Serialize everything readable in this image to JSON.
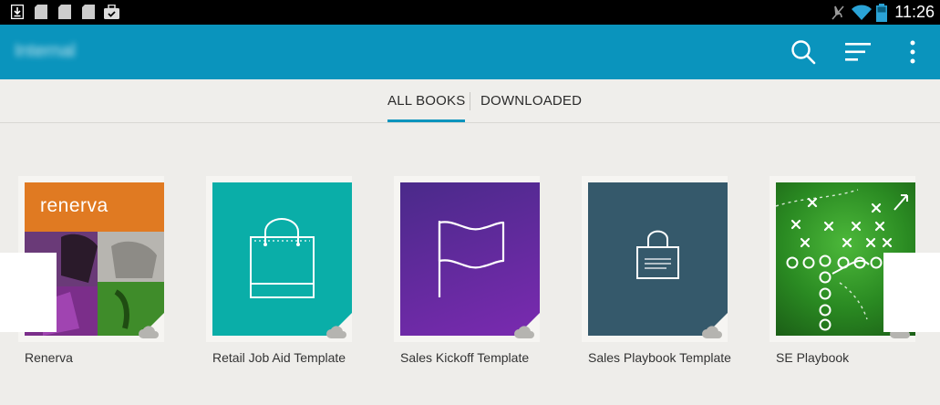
{
  "status_bar": {
    "time": "11:26",
    "left_icons": [
      "download-icon",
      "sd-card-icon",
      "sd-card-icon",
      "sd-card-icon",
      "briefcase-check-icon"
    ],
    "right_icons": [
      "mute-icon",
      "wifi-icon",
      "battery-icon"
    ]
  },
  "app_bar": {
    "title": "Internal",
    "color": "#0a94bd",
    "actions": [
      "search-icon",
      "sort-icon",
      "more-vert-icon"
    ]
  },
  "tabs": [
    {
      "label": "ALL BOOKS",
      "selected": true
    },
    {
      "label": "DOWNLOADED",
      "selected": false
    }
  ],
  "books": [
    {
      "title": "Renerva",
      "cover_text": "renerva",
      "cover_color": "#e07a22"
    },
    {
      "title": "Retail Job Aid Template",
      "cover_color": "#0aaea8"
    },
    {
      "title": "Sales Kickoff Template",
      "cover_color": "#6a2aa0"
    },
    {
      "title": "Sales Playbook Template",
      "cover_color": "#35596b"
    },
    {
      "title": "SE Playbook",
      "cover_color": "#2e8f2a"
    }
  ]
}
